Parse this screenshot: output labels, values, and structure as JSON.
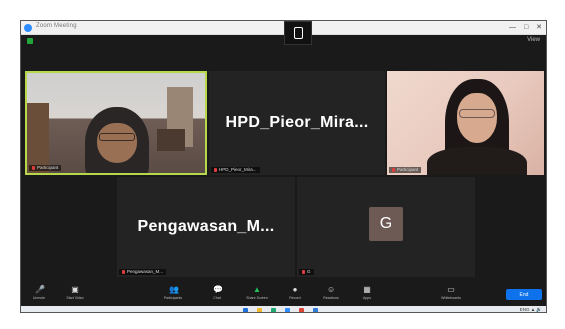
{
  "window": {
    "title": "Zoom Meeting",
    "controls": [
      "—",
      "□",
      "✕"
    ]
  },
  "meeting_bar": {
    "view_label": "View"
  },
  "tiles": [
    {
      "id": "p1",
      "name": "Participant",
      "active_speaker": true
    },
    {
      "id": "p2",
      "display_name": "HPD_Pieor_Mira...",
      "name": "HPD_Pieor_Mira..."
    },
    {
      "id": "p3",
      "name": "Participant"
    },
    {
      "id": "p4",
      "display_name": "Pengawasan_M...",
      "name": "Pengawasan_M..."
    },
    {
      "id": "p5",
      "avatar_letter": "G",
      "name": "G"
    }
  ],
  "toolbar": {
    "items": [
      {
        "id": "mute",
        "icon": "mic-muted-icon",
        "label": "Unmute",
        "glyph": "🎤"
      },
      {
        "id": "video",
        "icon": "video-icon",
        "label": "Start Video",
        "glyph": "▣"
      },
      {
        "id": "participants",
        "icon": "participants-icon",
        "label": "Participants",
        "glyph": "👥"
      },
      {
        "id": "chat",
        "icon": "chat-icon",
        "label": "Chat",
        "glyph": "💬"
      },
      {
        "id": "share",
        "icon": "share-screen-icon",
        "label": "Share Screen",
        "glyph": "▲"
      },
      {
        "id": "record",
        "icon": "record-icon",
        "label": "Record",
        "glyph": "●"
      },
      {
        "id": "reactions",
        "icon": "reactions-icon",
        "label": "Reactions",
        "glyph": "☺"
      },
      {
        "id": "apps",
        "icon": "apps-icon",
        "label": "Apps",
        "glyph": "▦"
      },
      {
        "id": "whiteboards",
        "icon": "whiteboard-icon",
        "label": "Whiteboards",
        "glyph": "▭"
      }
    ],
    "end_label": "End"
  },
  "taskbar": {
    "icons": [
      {
        "name": "windows-start-icon",
        "color": "#1e6fd9"
      },
      {
        "name": "file-explorer-icon",
        "color": "#f2b72b"
      },
      {
        "name": "edge-icon",
        "color": "#1fa870"
      },
      {
        "name": "zoom-icon",
        "color": "#2d8cff"
      },
      {
        "name": "chrome-icon",
        "color": "#db4437"
      },
      {
        "name": "store-icon",
        "color": "#2f7bd6"
      }
    ],
    "tray_text": "ENG  ▲  🔊"
  },
  "colors": {
    "active_border": "#b7d84b",
    "end_button": "#0e72ed",
    "muted_red": "#e03c3c"
  }
}
